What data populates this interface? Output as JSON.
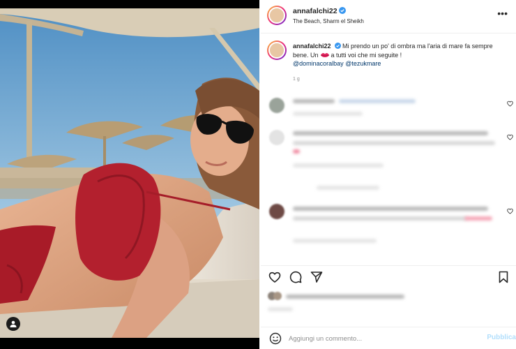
{
  "post": {
    "username": "annafalchi22",
    "location": "The Beach, Sharm el Sheikh",
    "caption_username": "annafalchi22",
    "caption_part1": "Mi prendo un po' di ombra ma l'aria di mare fa sempre bene. Un",
    "caption_part2": "a tutti voi che mi seguite !",
    "mention1": "@dominacoralbay",
    "mention2": "@tezukmare",
    "time": "1 g"
  },
  "add_comment": {
    "placeholder": "Aggiungi un commento...",
    "publish_label": "Pubblica"
  },
  "icons": {
    "verified": "verified-badge-icon",
    "more": "more-options-icon",
    "like": "heart-icon",
    "comment": "comment-icon",
    "share": "paper-plane-icon",
    "save": "bookmark-icon",
    "emoji": "smiley-icon",
    "tag": "user-tag-icon"
  },
  "colors": {
    "verified": "#3897f0",
    "link": "#00376b",
    "publish_disabled": "#b2dffc"
  }
}
